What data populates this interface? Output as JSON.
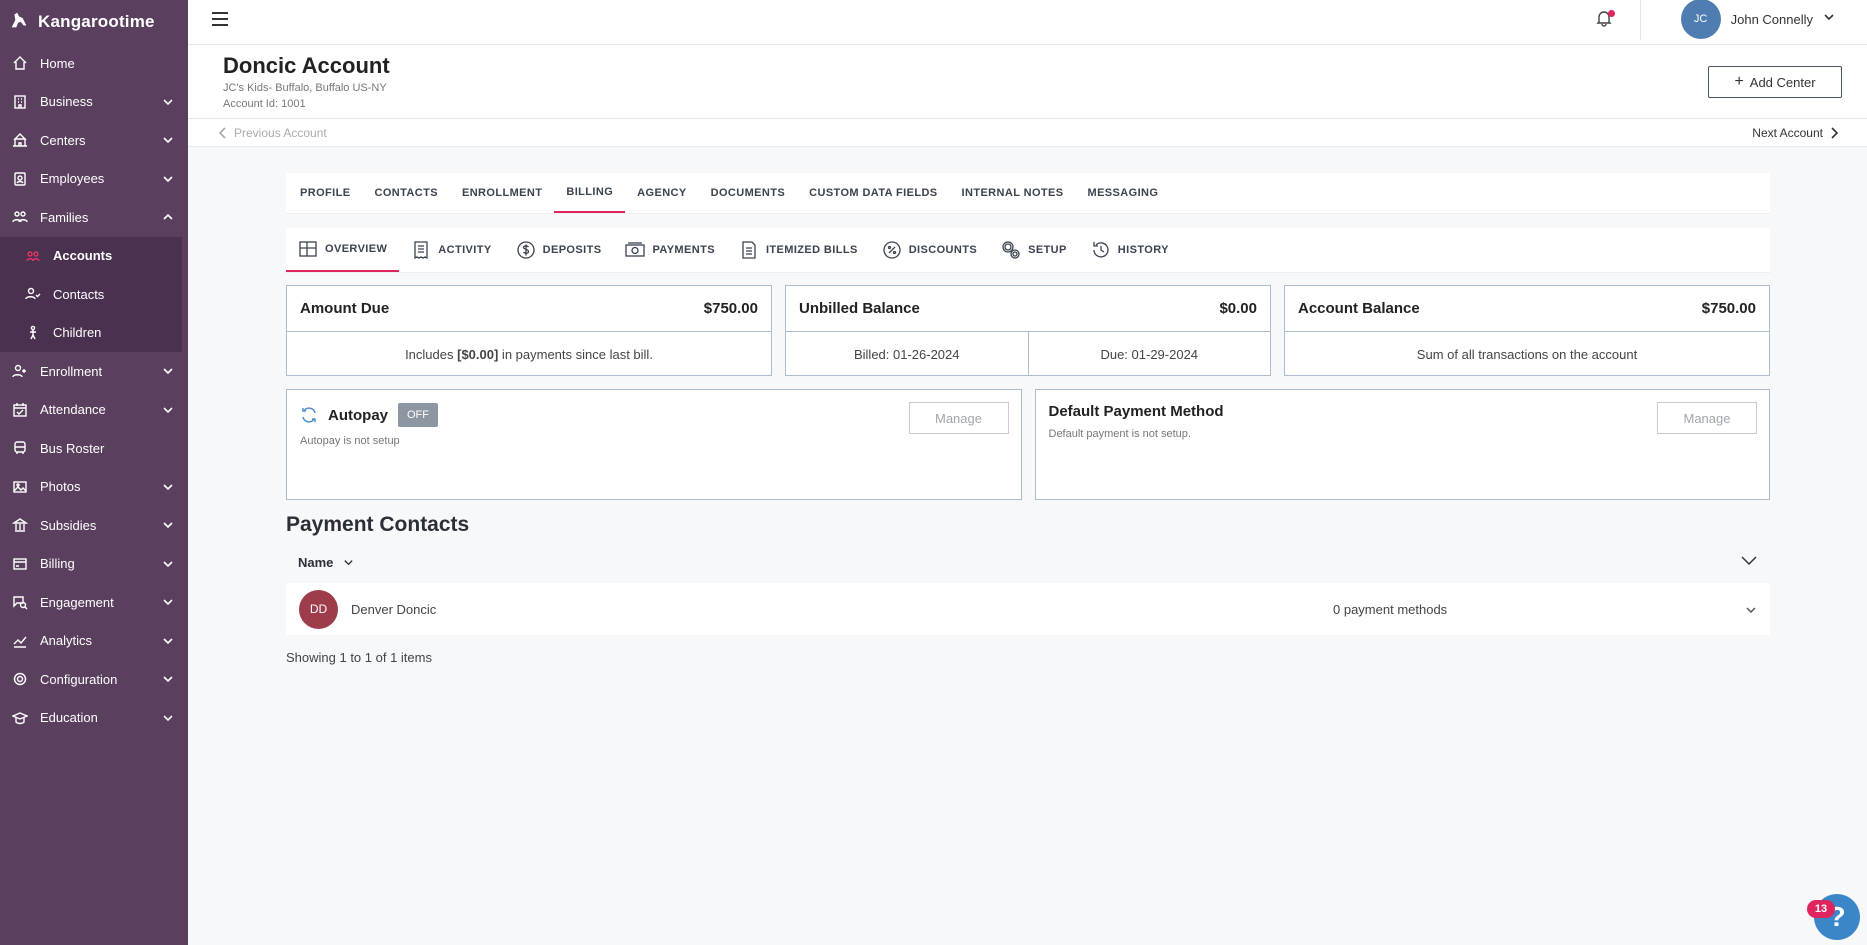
{
  "brand": {
    "name": "Kangarootime"
  },
  "sidebar": {
    "items": [
      {
        "label": "Home",
        "icon": "home-icon"
      },
      {
        "label": "Business",
        "icon": "building-icon"
      },
      {
        "label": "Centers",
        "icon": "school-icon"
      },
      {
        "label": "Employees",
        "icon": "id-badge-icon"
      },
      {
        "label": "Families",
        "icon": "family-icon"
      },
      {
        "label": "Enrollment",
        "icon": "user-plus-icon"
      },
      {
        "label": "Attendance",
        "icon": "calendar-check-icon"
      },
      {
        "label": "Bus Roster",
        "icon": "bus-icon"
      },
      {
        "label": "Photos",
        "icon": "image-icon"
      },
      {
        "label": "Subsidies",
        "icon": "bank-icon"
      },
      {
        "label": "Billing",
        "icon": "credit-card-icon"
      },
      {
        "label": "Engagement",
        "icon": "chat-search-icon"
      },
      {
        "label": "Analytics",
        "icon": "chart-line-icon"
      },
      {
        "label": "Configuration",
        "icon": "gear-icon"
      },
      {
        "label": "Education",
        "icon": "graduation-cap-icon"
      }
    ],
    "families_sub": [
      {
        "label": "Accounts",
        "icon": "accounts-icon"
      },
      {
        "label": "Contacts",
        "icon": "contacts-icon"
      },
      {
        "label": "Children",
        "icon": "child-icon"
      }
    ]
  },
  "topbar": {
    "user_initials": "JC",
    "user_name": "John Connelly"
  },
  "header": {
    "title": "Doncic Account",
    "center": "JC's Kids- Buffalo, Buffalo US-NY",
    "account_id": "Account Id: 1001",
    "add_center": "Add Center",
    "prev": "Previous Account",
    "next": "Next Account"
  },
  "tabs_primary": [
    "PROFILE",
    "CONTACTS",
    "ENROLLMENT",
    "BILLING",
    "AGENCY",
    "DOCUMENTS",
    "CUSTOM DATA FIELDS",
    "INTERNAL NOTES",
    "MESSAGING"
  ],
  "tabs_secondary": [
    "OVERVIEW",
    "ACTIVITY",
    "DEPOSITS",
    "PAYMENTS",
    "ITEMIZED BILLS",
    "DISCOUNTS",
    "SETUP",
    "HISTORY"
  ],
  "cards": {
    "amount_due": {
      "label": "Amount Due",
      "value": "$750.00",
      "note_pre": "Includes ",
      "note_bold": "[$0.00]",
      "note_post": " in payments since last bill."
    },
    "unbilled": {
      "label": "Unbilled Balance",
      "value": "$0.00",
      "billed": "Billed: 01-26-2024",
      "due": "Due: 01-29-2024"
    },
    "account_balance": {
      "label": "Account Balance",
      "value": "$750.00",
      "note": "Sum of all transactions on the account"
    }
  },
  "autopay": {
    "title": "Autopay",
    "state": "OFF",
    "sub": "Autopay is not setup",
    "manage": "Manage"
  },
  "default_payment": {
    "title": "Default Payment Method",
    "sub": "Default payment is not setup.",
    "manage": "Manage"
  },
  "payment_contacts": {
    "title": "Payment Contacts",
    "sort_label": "Name",
    "rows": [
      {
        "initials": "DD",
        "name": "Denver Doncic",
        "methods": "0 payment methods"
      }
    ],
    "showing": "Showing 1 to 1 of 1 items"
  },
  "help": {
    "badge": "13",
    "icon": "?"
  },
  "colors": {
    "sidebar": "#5a3f5e",
    "accent": "#e0245e",
    "card_border": "#a9bcd0"
  }
}
